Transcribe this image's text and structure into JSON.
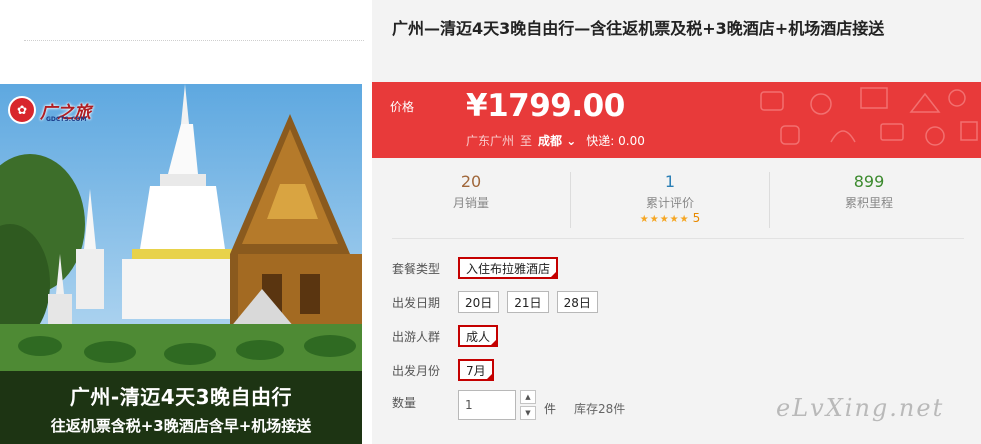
{
  "product": {
    "title": "广州—清迈4天3晚自由行—含往返机票及税+3晚酒店+机场酒店接送",
    "image": {
      "logo_text": "广之旅",
      "logo_sub": "GDCTS.COM",
      "banner_line1": "广州-清迈4天3晚自由行",
      "banner_line2": "往返机票含税+3晚酒店含早+机场接送"
    }
  },
  "price": {
    "label": "价格",
    "value": "¥1799.00",
    "origin": "广东广州",
    "to": "至",
    "destination": "成都",
    "shipping": "快递: 0.00"
  },
  "stats": [
    {
      "value": "20",
      "label": "月销量",
      "color": "#a0673a"
    },
    {
      "value": "1",
      "label": "累计评价",
      "color": "#2b7fb5",
      "stars": "★★★★★",
      "score": "5"
    },
    {
      "value": "899",
      "label": "累积里程",
      "color": "#3c8a2e"
    }
  ],
  "options": {
    "package": {
      "label": "套餐类型",
      "choices": [
        "入住布拉雅酒店"
      ],
      "selected": "入住布拉雅酒店"
    },
    "departure_date": {
      "label": "出发日期",
      "choices": [
        "20日",
        "21日",
        "28日"
      ]
    },
    "travelers": {
      "label": "出游人群",
      "choices": [
        "成人"
      ],
      "selected": "成人"
    },
    "departure_month": {
      "label": "出发月份",
      "choices": [
        "7月"
      ],
      "selected": "7月"
    },
    "quantity": {
      "label": "数量",
      "value": "1",
      "unit": "件",
      "stock": "库存28件"
    }
  },
  "watermark": "eLvXing.net",
  "colors": {
    "price_bg": "#e83a3a",
    "selected_border": "#c40000",
    "panel_bg": "#f3f3f3"
  }
}
